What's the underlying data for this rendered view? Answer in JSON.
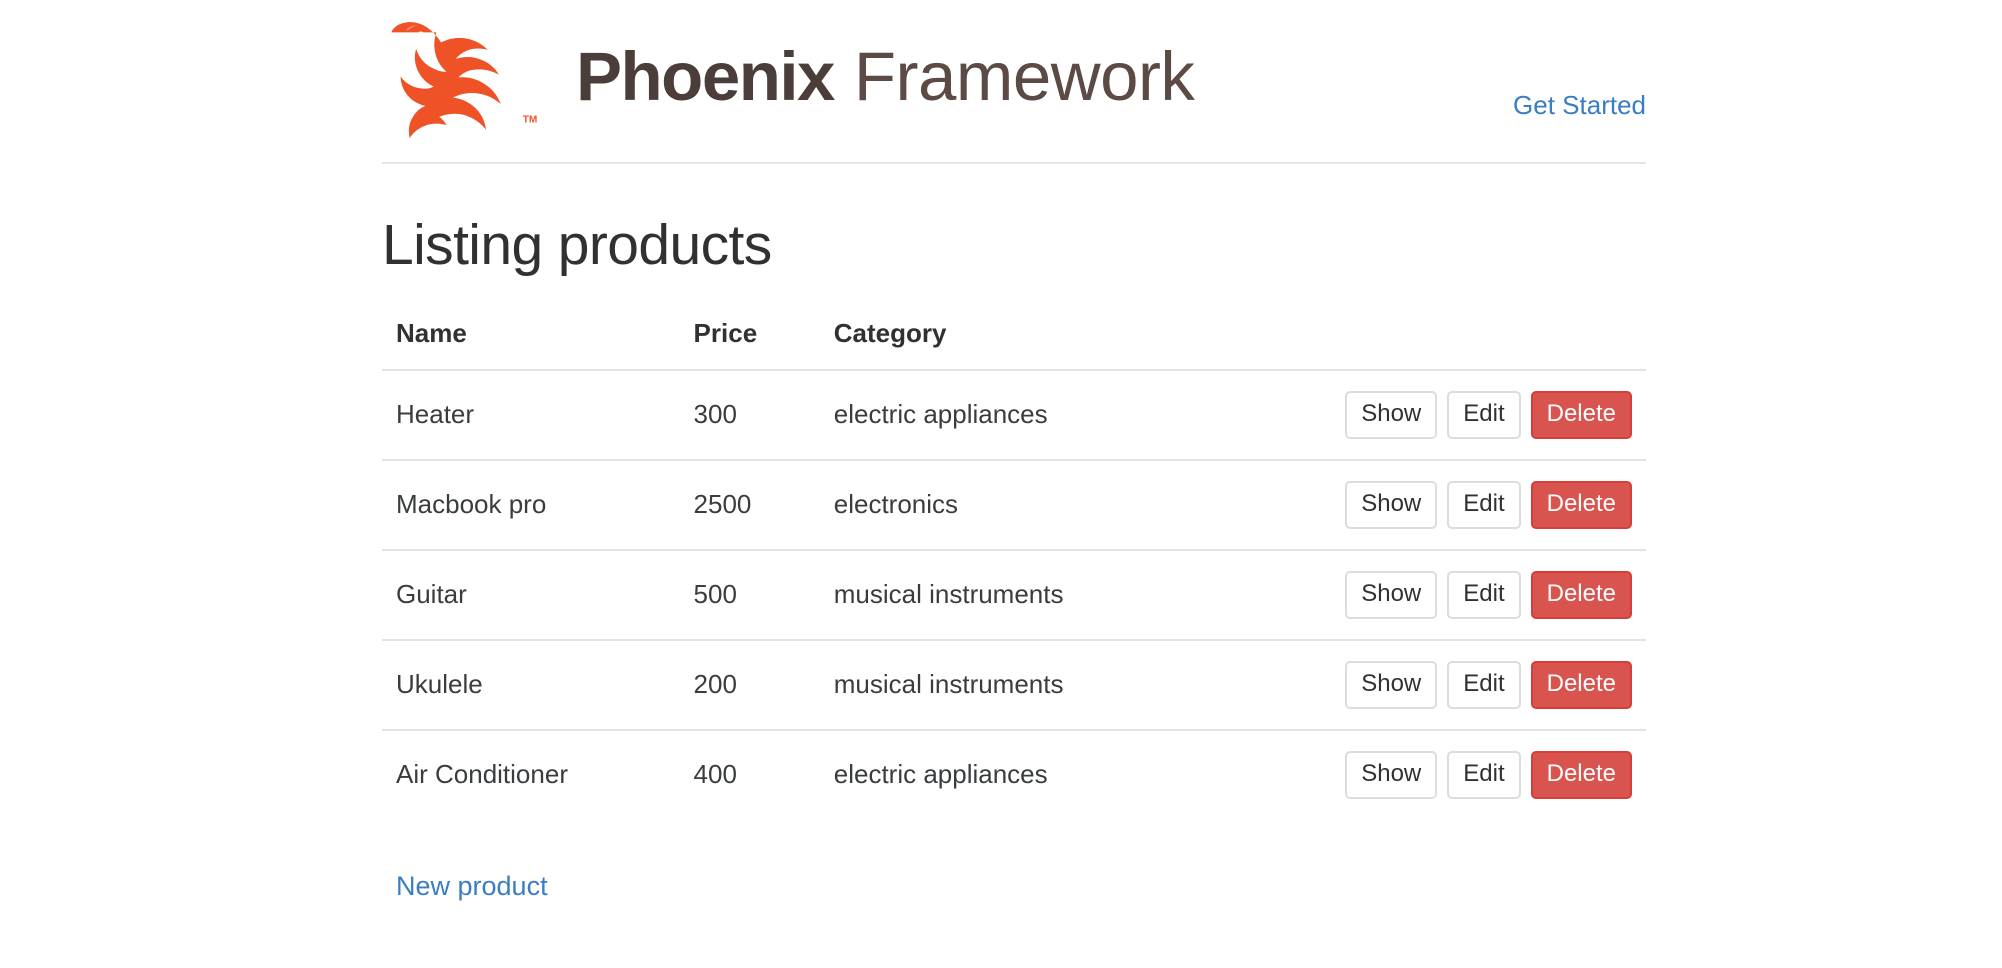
{
  "header": {
    "brand": {
      "logo_icon": "phoenix-bird-logo",
      "name": "Phoenix",
      "subtitle": "Framework",
      "trademark": "TM"
    },
    "nav": {
      "get_started_label": "Get Started"
    }
  },
  "main": {
    "page_title": "Listing products",
    "table": {
      "columns": [
        "Name",
        "Price",
        "Category",
        ""
      ],
      "rows": [
        {
          "name": "Heater",
          "price": "300",
          "category": "electric appliances",
          "actions": {
            "show": "Show",
            "edit": "Edit",
            "delete": "Delete"
          }
        },
        {
          "name": "Macbook pro",
          "price": "2500",
          "category": "electronics",
          "actions": {
            "show": "Show",
            "edit": "Edit",
            "delete": "Delete"
          }
        },
        {
          "name": "Guitar",
          "price": "500",
          "category": "musical instruments",
          "actions": {
            "show": "Show",
            "edit": "Edit",
            "delete": "Delete"
          }
        },
        {
          "name": "Ukulele",
          "price": "200",
          "category": "musical instruments",
          "actions": {
            "show": "Show",
            "edit": "Edit",
            "delete": "Delete"
          }
        },
        {
          "name": "Air Conditioner",
          "price": "400",
          "category": "electric appliances",
          "actions": {
            "show": "Show",
            "edit": "Edit",
            "delete": "Delete"
          }
        }
      ]
    },
    "new_product_label": "New product"
  },
  "colors": {
    "brand_orange": "#f05228",
    "brand_text": "#4b3d39",
    "link_blue": "#3b7dc2",
    "danger_red": "#d9534f",
    "border_gray": "#e3e3e3"
  }
}
